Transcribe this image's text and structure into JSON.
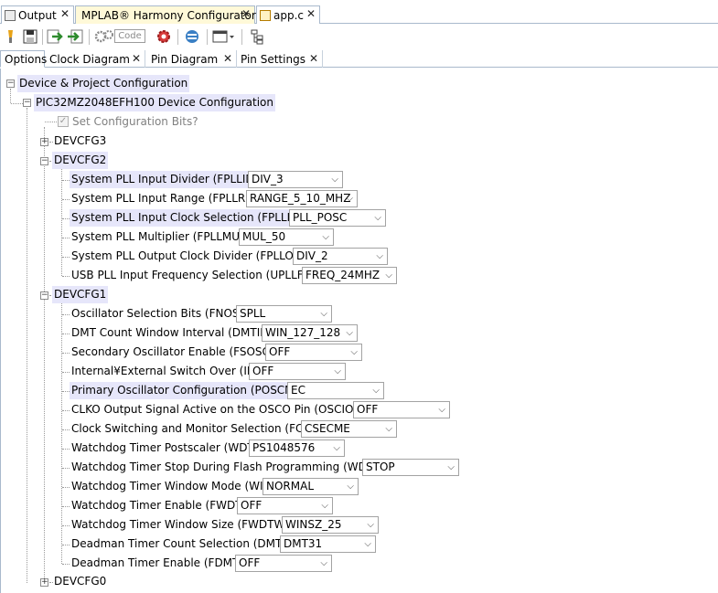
{
  "editor_tabs": [
    {
      "label": "Output",
      "icon": "output-window-icon"
    },
    {
      "label": "MPLAB® Harmony Configurator",
      "icon": ""
    },
    {
      "label": "app.c",
      "icon": "c-source-file-icon"
    }
  ],
  "toolbar": {
    "code_button_label": "Code"
  },
  "config_tabs": {
    "options": "Options",
    "clock": "Clock Diagram",
    "pin": "Pin Diagram",
    "settings": "Pin Settings"
  },
  "tree": {
    "root": "Device & Project Configuration",
    "device": "PIC32MZ2048EFH100 Device Configuration",
    "set_config_bits": "Set Configuration Bits?",
    "devcfg3": "DEVCFG3",
    "devcfg2": {
      "label": "DEVCFG2",
      "settings": [
        {
          "label": "System PLL Input Divider (FPLLIDIV)",
          "value": "DIV_3"
        },
        {
          "label": "System PLL Input Range (FPLLRNG)",
          "value": "RANGE_5_10_MHZ"
        },
        {
          "label": "System PLL Input Clock Selection (FPLLICLK)",
          "value": "PLL_POSC"
        },
        {
          "label": "System PLL Multiplier (FPLLMULT)",
          "value": "MUL_50"
        },
        {
          "label": "System PLL Output Clock Divider (FPLLODIV)",
          "value": "DIV_2"
        },
        {
          "label": "USB PLL Input Frequency Selection (UPLLFSEL)",
          "value": "FREQ_24MHZ"
        }
      ]
    },
    "devcfg1": {
      "label": "DEVCFG1",
      "settings": [
        {
          "label": "Oscillator Selection Bits (FNOSC)",
          "value": "SPLL"
        },
        {
          "label": "DMT Count Window Interval (DMTINTV)",
          "value": "WIN_127_128"
        },
        {
          "label": "Secondary Oscillator Enable (FSOSCEN)",
          "value": "OFF"
        },
        {
          "label": "Internal¥External Switch Over (IESO)",
          "value": "OFF"
        },
        {
          "label": "Primary Oscillator Configuration (POSCMOD)",
          "value": "EC"
        },
        {
          "label": "CLKO Output Signal Active on the OSCO Pin (OSCIOFNC)",
          "value": "OFF"
        },
        {
          "label": "Clock Switching and Monitor Selection (FCKSM)",
          "value": "CSECME"
        },
        {
          "label": "Watchdog Timer Postscaler (WDTPS)",
          "value": "PS1048576"
        },
        {
          "label": "Watchdog Timer Stop During Flash Programming (WDTSPGM)",
          "value": "STOP"
        },
        {
          "label": "Watchdog Timer Window Mode (WINDIS)",
          "value": "NORMAL"
        },
        {
          "label": "Watchdog Timer Enable (FWDTEN)",
          "value": "OFF"
        },
        {
          "label": "Watchdog Timer Window Size (FWDTWINSZ)",
          "value": "WINSZ_25"
        },
        {
          "label": "Deadman Timer Count Selection (DMTCNT)",
          "value": "DMT31"
        },
        {
          "label": "Deadman Timer Enable (FDMTEN)",
          "value": "OFF"
        }
      ]
    },
    "devcfg0": "DEVCFG0"
  },
  "colors": {
    "selection_highlight": "#e6e6fa",
    "active_editor_tab": "#fff9d8",
    "tab_border": "#a9b9cc"
  }
}
